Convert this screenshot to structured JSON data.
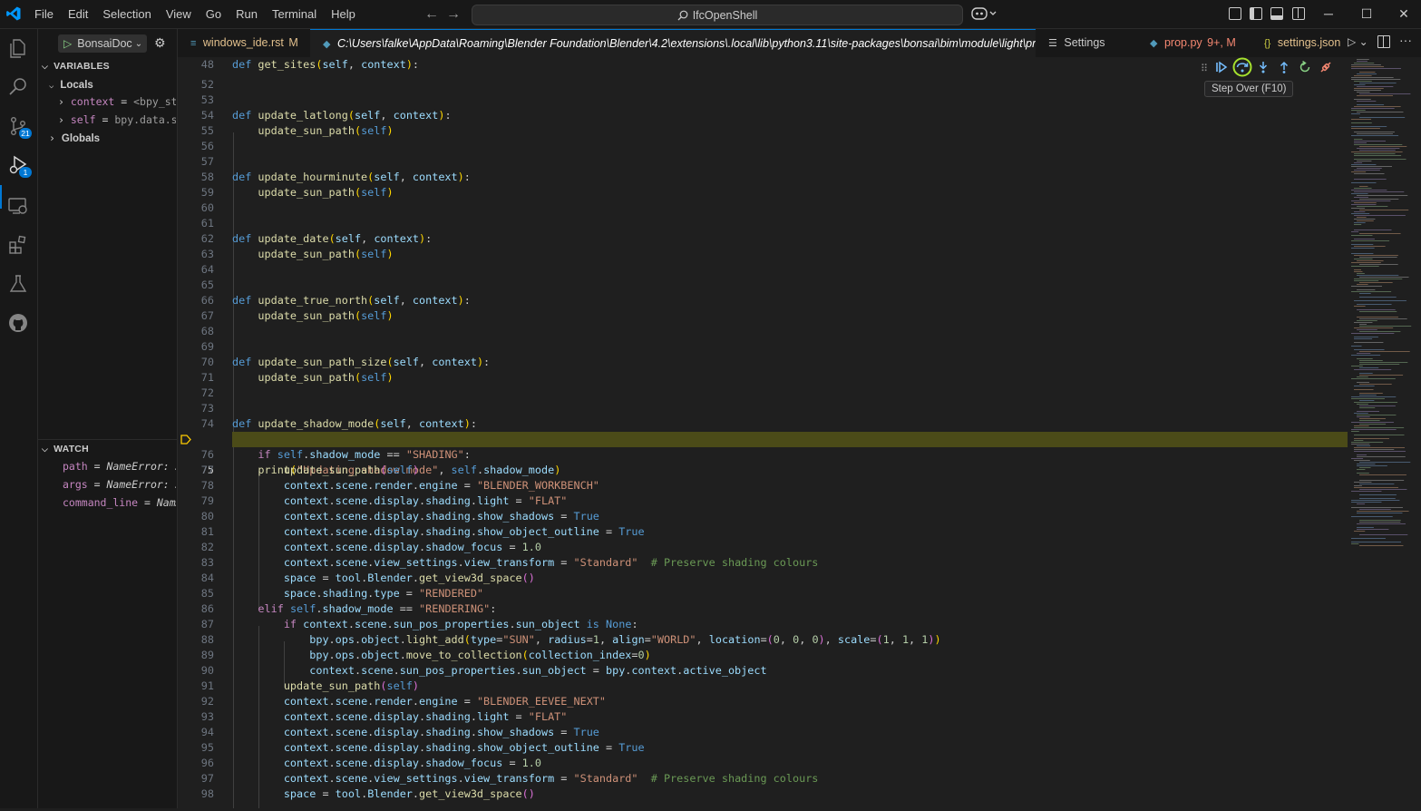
{
  "menu": [
    "File",
    "Edit",
    "Selection",
    "View",
    "Go",
    "Run",
    "Terminal",
    "Help"
  ],
  "command_center": "IfcOpenShell",
  "window_controls": {
    "minimize": "─",
    "maximize": "☐",
    "close": "✕"
  },
  "activity": {
    "scm_badge": "21",
    "debug_badge": "1"
  },
  "run_config": {
    "label": "BonsaiDoc"
  },
  "variables": {
    "title": "VARIABLES",
    "locals_label": "Locals",
    "globals_label": "Globals",
    "locals": [
      {
        "name": "context",
        "value": "<bpy_st…"
      },
      {
        "name": "self",
        "value": "bpy.data.s…"
      }
    ]
  },
  "watch": {
    "title": "WATCH",
    "items": [
      {
        "name": "path",
        "value": "NameError: …"
      },
      {
        "name": "args",
        "value": "NameError: …"
      },
      {
        "name": "command_line",
        "value": "Nam…"
      }
    ]
  },
  "tabs": [
    {
      "label": "windows_ide.rst",
      "status": "M"
    },
    {
      "label": "C:\\Users\\falke\\AppData\\Roaming\\Blender Foundation\\Blender\\4.2\\extensions\\.local\\lib\\python3.11\\site-packages\\bonsai\\bim\\module\\light\\prop.py",
      "status": ""
    },
    {
      "label": "Settings",
      "status": ""
    },
    {
      "label": "prop.py",
      "status": "9+, M"
    },
    {
      "label": "settings.json",
      "status": ""
    }
  ],
  "tooltip": "Step Over (F10)",
  "current_line": 75,
  "line_numbers": [
    "48",
    "52",
    "53",
    "54",
    "55",
    "56",
    "57",
    "58",
    "59",
    "60",
    "61",
    "62",
    "63",
    "64",
    "65",
    "66",
    "67",
    "68",
    "69",
    "70",
    "71",
    "72",
    "73",
    "74",
    "75",
    "76",
    "77",
    "78",
    "79",
    "80",
    "81",
    "82",
    "83",
    "84",
    "85",
    "86",
    "87",
    "88",
    "89",
    "90",
    "91",
    "92",
    "93",
    "94",
    "95",
    "96",
    "97",
    "98"
  ],
  "code": {
    "sites": "get_sites",
    "latlong": "update_latlong",
    "hourminute": "update_hourminute",
    "date": "update_date",
    "true_north": "update_true_north",
    "sun_path_size": "update_sun_path_size",
    "shadow_mode": "update_shadow_mode",
    "sun_path_call": "update_sun_path",
    "print_msg": "\"Updating shadow mode\"",
    "shading": "\"SHADING\"",
    "workbench": "\"BLENDER_WORKBENCH\"",
    "flat": "\"FLAT\"",
    "standard": "\"Standard\"",
    "comment": "# Preserve shading colours",
    "rendered": "\"RENDERED\"",
    "rendering": "\"RENDERING\"",
    "sun": "\"SUN\"",
    "world": "\"WORLD\"",
    "eevee": "\"BLENDER_EEVEE_NEXT\"",
    "one_point_zero": "1.0"
  }
}
